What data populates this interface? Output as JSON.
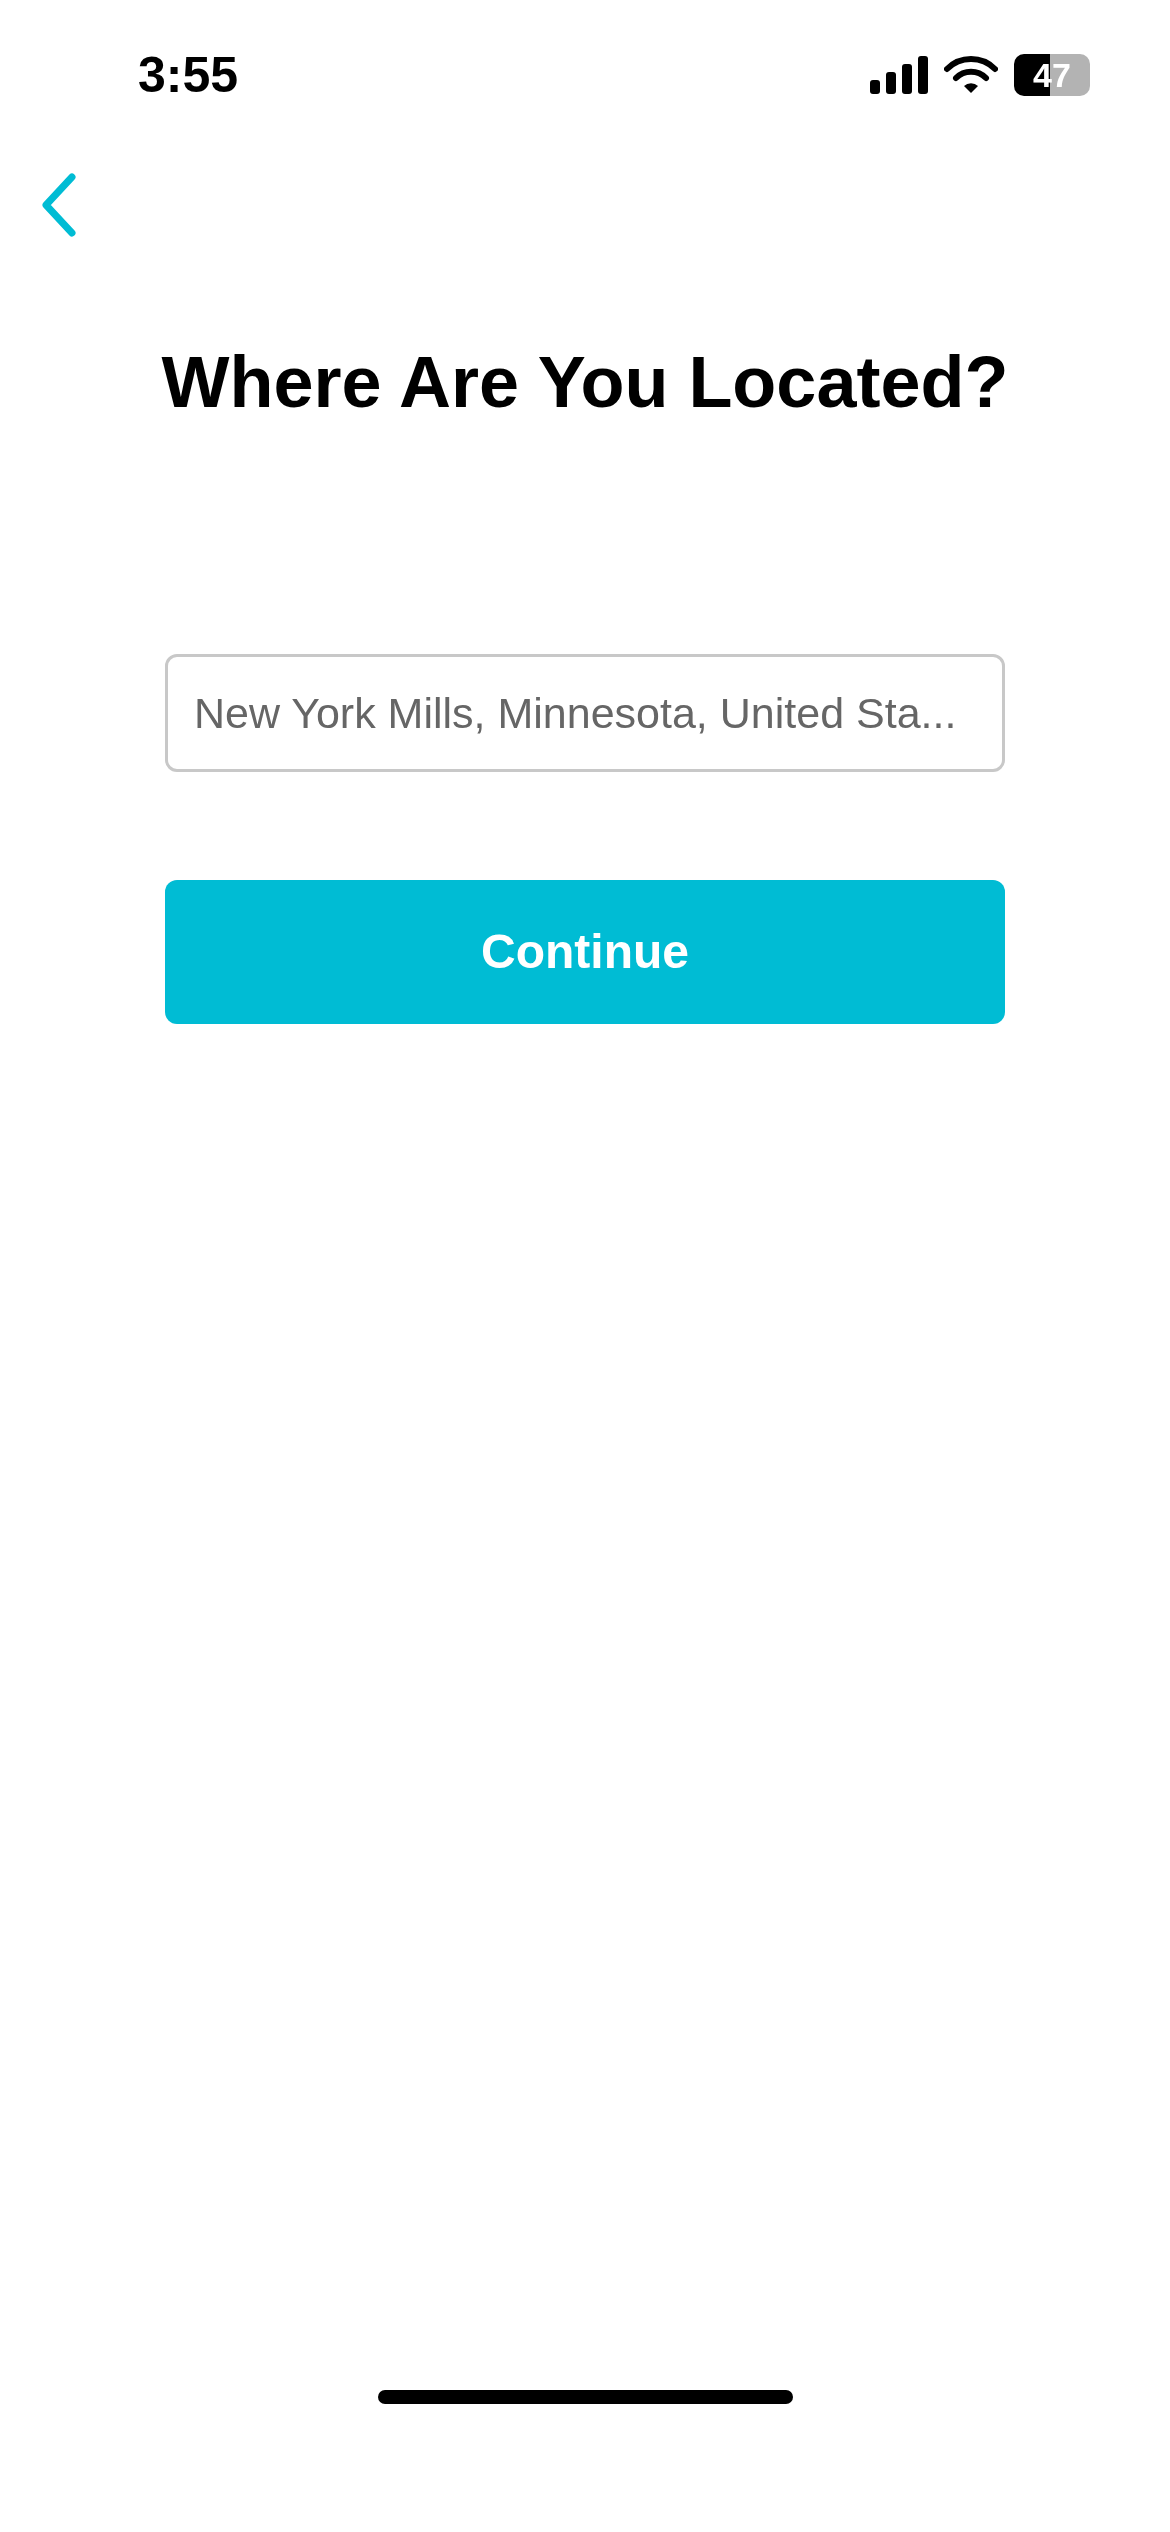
{
  "status_bar": {
    "time": "3:55",
    "battery": "47"
  },
  "title": "Where Are You Located?",
  "location_field": {
    "value": "New York Mills, Minnesota, United Sta..."
  },
  "continue_button": {
    "label": "Continue"
  }
}
